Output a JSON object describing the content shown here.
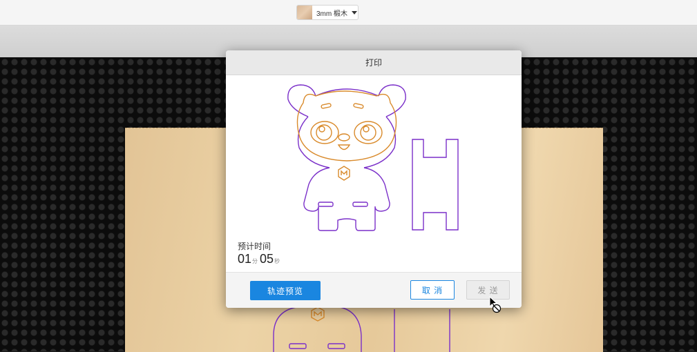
{
  "toolbar": {
    "material_label": "3mm 椴木",
    "material_swatch_icon": "wood-swatch-icon"
  },
  "dialog": {
    "title": "打印",
    "estimate_label": "预计时间",
    "estimate_minutes": "01",
    "minutes_unit": "分",
    "estimate_seconds": "05",
    "seconds_unit": "秒",
    "preview_button": "轨迹预览",
    "cancel_button": "取 消",
    "send_button": "发 送"
  },
  "colors": {
    "accent": "#1a86e0",
    "cut_line": "#7a2fc9",
    "engrave_line": "#d98a2b"
  }
}
